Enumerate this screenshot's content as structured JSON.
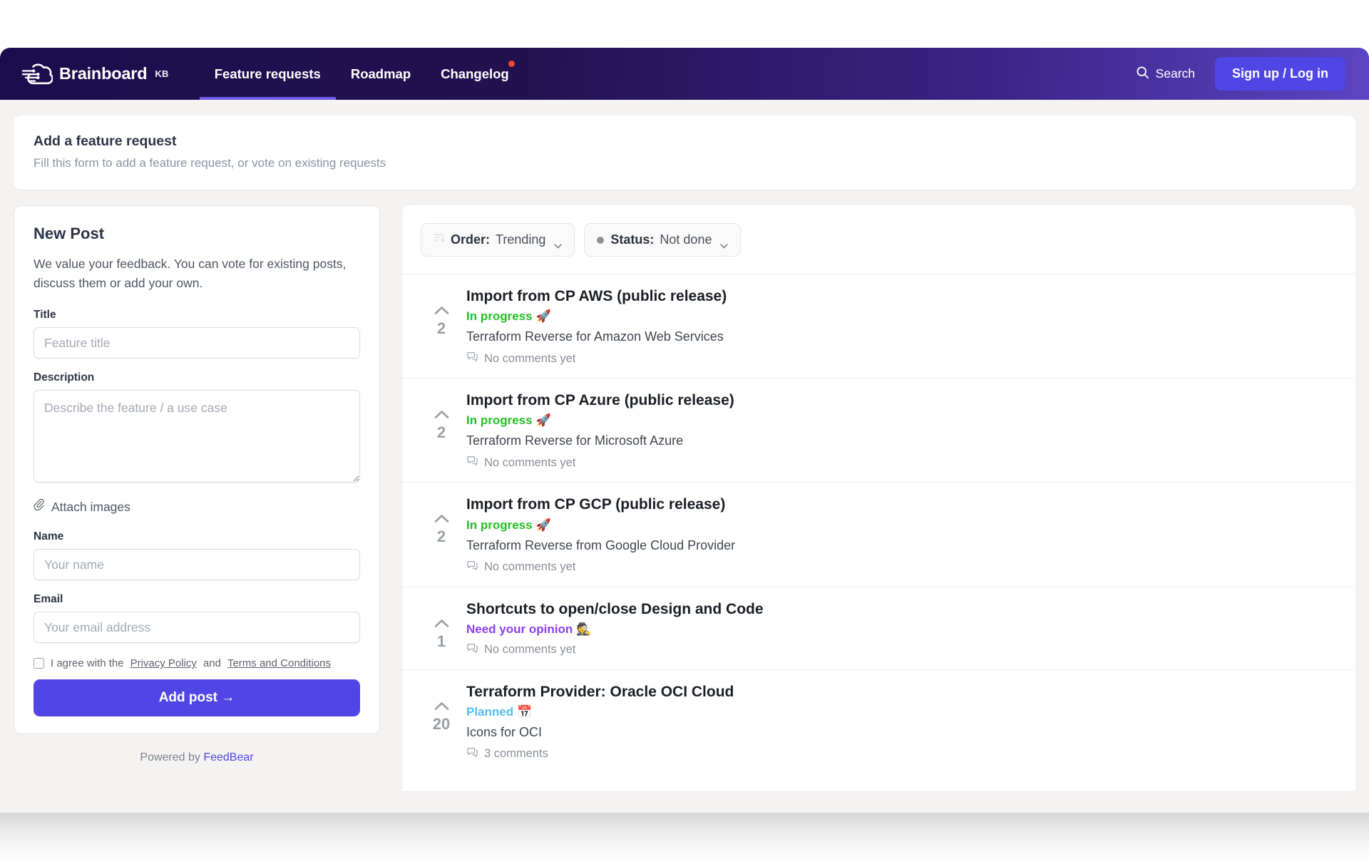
{
  "header": {
    "brand_name": "Brainboard",
    "brand_suffix": "KB",
    "logo_icon": "cloud-circuit-logo",
    "nav": [
      {
        "label": "Feature requests",
        "active": true,
        "dot": false
      },
      {
        "label": "Roadmap",
        "active": false,
        "dot": false
      },
      {
        "label": "Changelog",
        "active": false,
        "dot": true
      }
    ],
    "search_label": "Search",
    "search_icon": "search-icon",
    "signup_label": "Sign up / Log in",
    "accent_color": "#5046e5",
    "dot_color": "#f4452e"
  },
  "intro": {
    "title": "Add a feature request",
    "subtitle": "Fill this form to add a feature request, or vote on existing requests"
  },
  "new_post": {
    "heading": "New Post",
    "description": "We value your feedback. You can vote for existing posts, discuss them or add your own.",
    "title_label": "Title",
    "title_placeholder": "Feature title",
    "title_value": "",
    "description_label": "Description",
    "description_placeholder": "Describe the feature / a use case",
    "description_value": "",
    "attach_label": "Attach images",
    "attach_icon": "paperclip-icon",
    "name_label": "Name",
    "name_placeholder": "Your name",
    "name_value": "",
    "email_label": "Email",
    "email_placeholder": "Your email address",
    "email_value": "",
    "agree_prefix": "I agree with the",
    "agree_privacy": "Privacy Policy",
    "agree_and": "and",
    "agree_terms": "Terms and Conditions",
    "agree_checked": false,
    "submit_label": "Add post →",
    "powered_prefix": "Powered by ",
    "powered_brand": "FeedBear"
  },
  "filters": {
    "order": {
      "label": "Order:",
      "value": "Trending",
      "icon": "sort-descending-icon"
    },
    "status": {
      "label": "Status:",
      "value": "Not done",
      "icon": "status-dot-icon",
      "dot_color": "#8f9398"
    }
  },
  "posts": [
    {
      "title": "Import from CP AWS (public release)",
      "status": "In progress",
      "status_emoji": "🚀",
      "status_color": "#21c021",
      "body": "Terraform Reverse for Amazon Web Services",
      "comments": "No comments yet",
      "votes": "2"
    },
    {
      "title": "Import from CP Azure (public release)",
      "status": "In progress",
      "status_emoji": "🚀",
      "status_color": "#21c021",
      "body": "Terraform Reverse for Microsoft Azure",
      "comments": "No comments yet",
      "votes": "2"
    },
    {
      "title": "Import from CP GCP (public release)",
      "status": "In progress",
      "status_emoji": "🚀",
      "status_color": "#21c021",
      "body": "Terraform Reverse from Google Cloud Provider",
      "comments": "No comments yet",
      "votes": "2"
    },
    {
      "title": "Shortcuts to open/close Design and Code",
      "status": "Need your opinion",
      "status_emoji": "🕵️",
      "status_color": "#8b3ef0",
      "body": "",
      "comments": "No comments yet",
      "votes": "1"
    },
    {
      "title": "Terraform Provider: Oracle OCI Cloud",
      "status": "Planned",
      "status_emoji": "📅",
      "status_color": "#56bdf5",
      "body": "Icons for OCI",
      "comments": "3 comments",
      "votes": "20"
    }
  ]
}
